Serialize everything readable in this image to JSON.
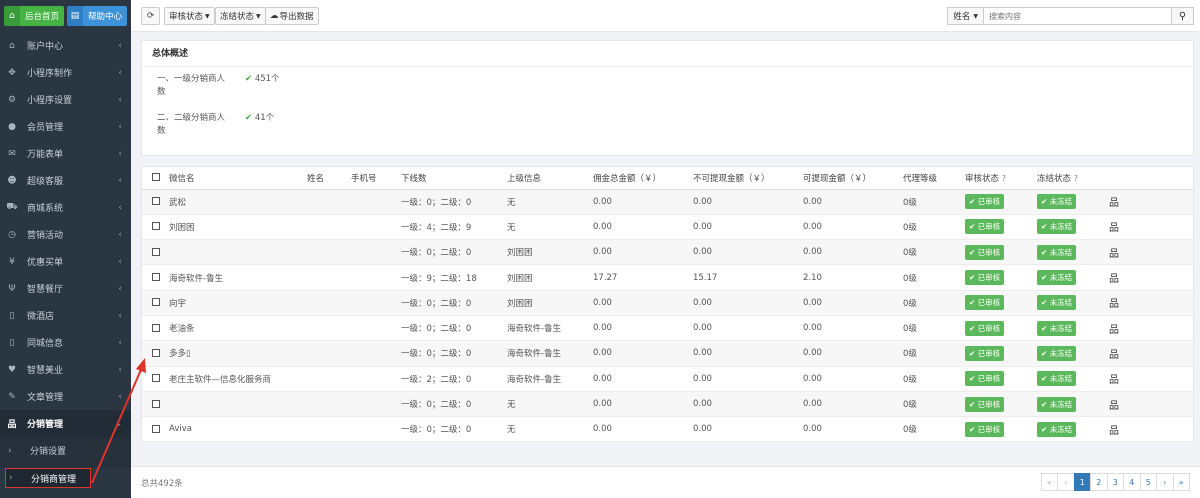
{
  "top_buttons": {
    "home": "后台首页",
    "help": "帮助中心"
  },
  "menu": [
    {
      "label": "账户中心",
      "icon": "home-icon"
    },
    {
      "label": "小程序制作",
      "icon": "move-icon"
    },
    {
      "label": "小程序设置",
      "icon": "gear-icon"
    },
    {
      "label": "会员管理",
      "icon": "user-icon"
    },
    {
      "label": "万能表单",
      "icon": "mail-icon"
    },
    {
      "label": "超级客服",
      "icon": "users-icon"
    },
    {
      "label": "商城系统",
      "icon": "cart-icon"
    },
    {
      "label": "营销活动",
      "icon": "clock-icon"
    },
    {
      "label": "优惠买单",
      "icon": "yen-icon"
    },
    {
      "label": "智慧餐厅",
      "icon": "cutlery-icon"
    },
    {
      "label": "微酒店",
      "icon": "file-icon"
    },
    {
      "label": "同城信息",
      "icon": "file-icon"
    },
    {
      "label": "智慧美业",
      "icon": "heart-icon"
    },
    {
      "label": "文章管理",
      "icon": "pencil-icon"
    }
  ],
  "active_menu": {
    "label": "分销管理",
    "icon": "sitemap-icon"
  },
  "submenu": [
    {
      "label": "分销设置"
    },
    {
      "label": "分销商管理"
    }
  ],
  "toolbar": {
    "refresh_icon": "refresh-icon",
    "audit_status": "审核状态",
    "freeze_status": "冻结状态",
    "export": "导出数据",
    "search_field": "姓名",
    "search_placeholder": "搜索内容"
  },
  "overview": {
    "title": "总体概述",
    "items": [
      {
        "label": "一、一级分销商人数",
        "value": "451个"
      },
      {
        "label": "二、二级分销商人数",
        "value": "41个"
      }
    ]
  },
  "table": {
    "headers": [
      "微信名",
      "姓名",
      "手机号",
      "下线数",
      "上级信息",
      "佣金总金额（￥）",
      "不可提现金额（￥）",
      "可提现金额（￥）",
      "代理等级",
      "审核状态",
      "冻结状态",
      ""
    ],
    "help_mark": "?",
    "rows": [
      {
        "wechat": "武松",
        "name": "",
        "phone": "",
        "downline": "一级：0；二级：0",
        "parent": "无",
        "total": "0.00",
        "locked": "0.00",
        "withdrawable": "0.00",
        "level": "0级",
        "audit": "已审核",
        "freeze": "未冻结"
      },
      {
        "wechat": "刘困困",
        "name": "",
        "phone": "",
        "downline": "一级：4；二级：9",
        "parent": "无",
        "total": "0.00",
        "locked": "0.00",
        "withdrawable": "0.00",
        "level": "0级",
        "audit": "已审核",
        "freeze": "未冻结"
      },
      {
        "wechat": "",
        "name": "",
        "phone": "",
        "downline": "一级：0；二级：0",
        "parent": "刘困困",
        "total": "0.00",
        "locked": "0.00",
        "withdrawable": "0.00",
        "level": "0级",
        "audit": "已审核",
        "freeze": "未冻结"
      },
      {
        "wechat": "海奇软件-鲁生",
        "name": "",
        "phone": "",
        "downline": "一级：9；二级：18",
        "parent": "刘困困",
        "total": "17.27",
        "locked": "15.17",
        "withdrawable": "2.10",
        "level": "0级",
        "audit": "已审核",
        "freeze": "未冻结"
      },
      {
        "wechat": "向宇",
        "name": "",
        "phone": "",
        "downline": "一级：0；二级：0",
        "parent": "刘困困",
        "total": "0.00",
        "locked": "0.00",
        "withdrawable": "0.00",
        "level": "0级",
        "audit": "已审核",
        "freeze": "未冻结"
      },
      {
        "wechat": "老油条",
        "name": "",
        "phone": "",
        "downline": "一级：0；二级：0",
        "parent": "海奇软件-鲁生",
        "total": "0.00",
        "locked": "0.00",
        "withdrawable": "0.00",
        "level": "0级",
        "audit": "已审核",
        "freeze": "未冻结"
      },
      {
        "wechat": "多多▯",
        "name": "",
        "phone": "",
        "downline": "一级：0；二级：0",
        "parent": "海奇软件-鲁生",
        "total": "0.00",
        "locked": "0.00",
        "withdrawable": "0.00",
        "level": "0级",
        "audit": "已审核",
        "freeze": "未冻结"
      },
      {
        "wechat": "老庄主软件—信息化服务商",
        "name": "",
        "phone": "",
        "downline": "一级：2；二级：0",
        "parent": "海奇软件-鲁生",
        "total": "0.00",
        "locked": "0.00",
        "withdrawable": "0.00",
        "level": "0级",
        "audit": "已审核",
        "freeze": "未冻结"
      },
      {
        "wechat": "",
        "name": "",
        "phone": "",
        "downline": "一级：0；二级：0",
        "parent": "无",
        "total": "0.00",
        "locked": "0.00",
        "withdrawable": "0.00",
        "level": "0级",
        "audit": "已审核",
        "freeze": "未冻结"
      },
      {
        "wechat": "Aviva",
        "name": "",
        "phone": "",
        "downline": "一级：0；二级：0",
        "parent": "无",
        "total": "0.00",
        "locked": "0.00",
        "withdrawable": "0.00",
        "level": "0级",
        "audit": "已审核",
        "freeze": "未冻结"
      }
    ]
  },
  "footer": {
    "total": "总共492条",
    "pager": [
      "«",
      "‹",
      "1",
      "2",
      "3",
      "4",
      "5",
      "›",
      "»"
    ],
    "current_page": "1"
  }
}
